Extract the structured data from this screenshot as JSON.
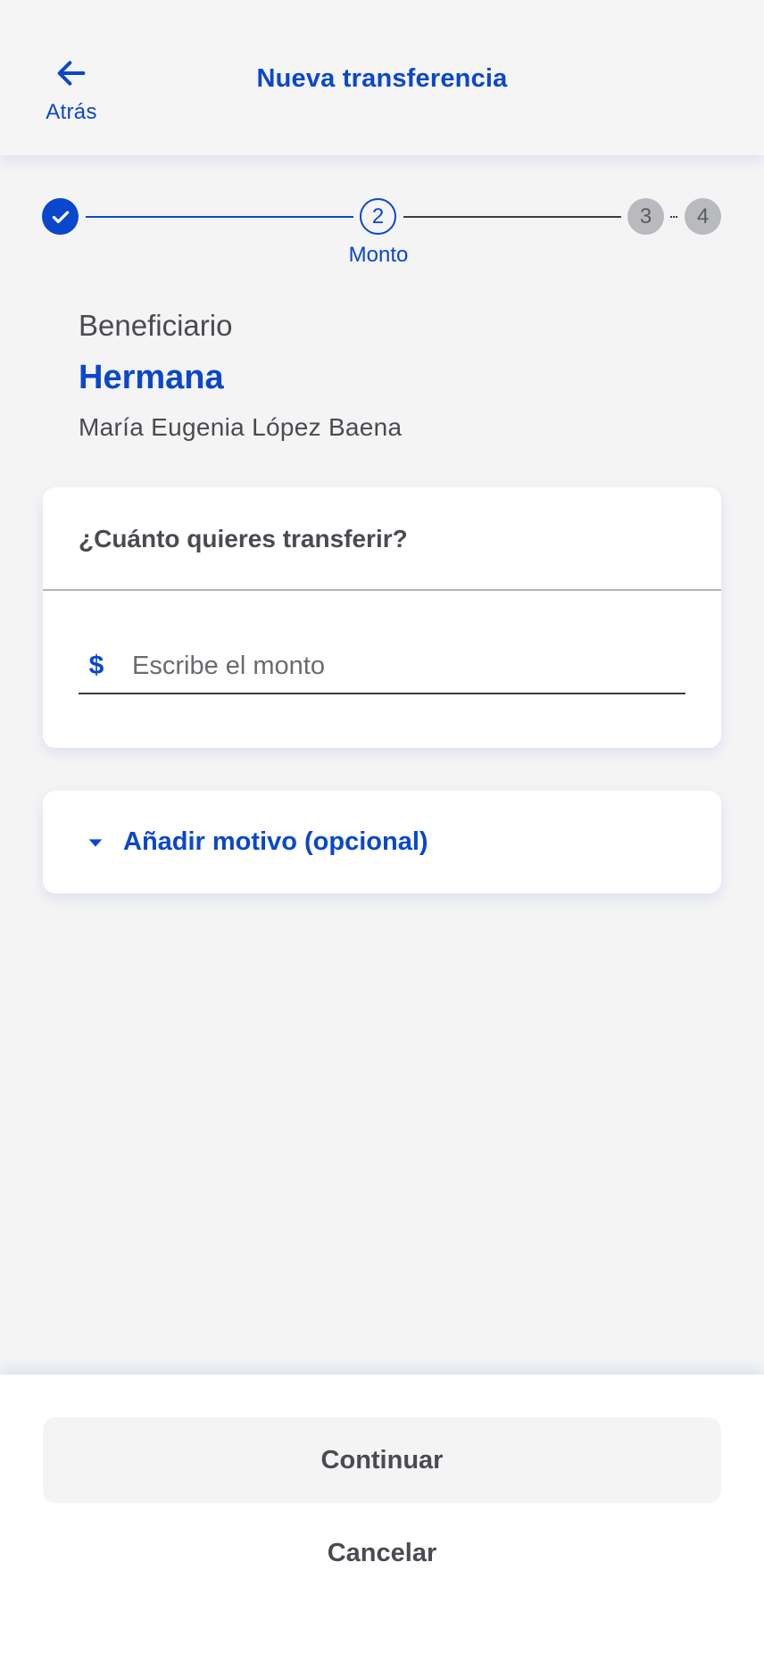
{
  "header": {
    "back_label": "Atrás",
    "title": "Nueva transferencia"
  },
  "stepper": {
    "steps": [
      {
        "number": "1",
        "state": "completed"
      },
      {
        "number": "2",
        "state": "current",
        "label": "Monto"
      },
      {
        "number": "3",
        "state": "pending"
      },
      {
        "number": "4",
        "state": "pending"
      }
    ]
  },
  "beneficiary": {
    "label": "Beneficiario",
    "alias": "Hermana",
    "name": "María Eugenia López Baena"
  },
  "amount": {
    "question": "¿Cuánto quieres transferir?",
    "currency_symbol": "$",
    "placeholder": "Escribe el monto",
    "value": ""
  },
  "reason": {
    "label": "Añadir motivo (opcional)",
    "icon": "caret-down-icon"
  },
  "actions": {
    "continue_label": "Continuar",
    "cancel_label": "Cancelar"
  },
  "colors": {
    "accent": "#0b47cc",
    "text": "#4a4a52",
    "background": "#f4f4f5",
    "pending_step": "#b9babd"
  }
}
